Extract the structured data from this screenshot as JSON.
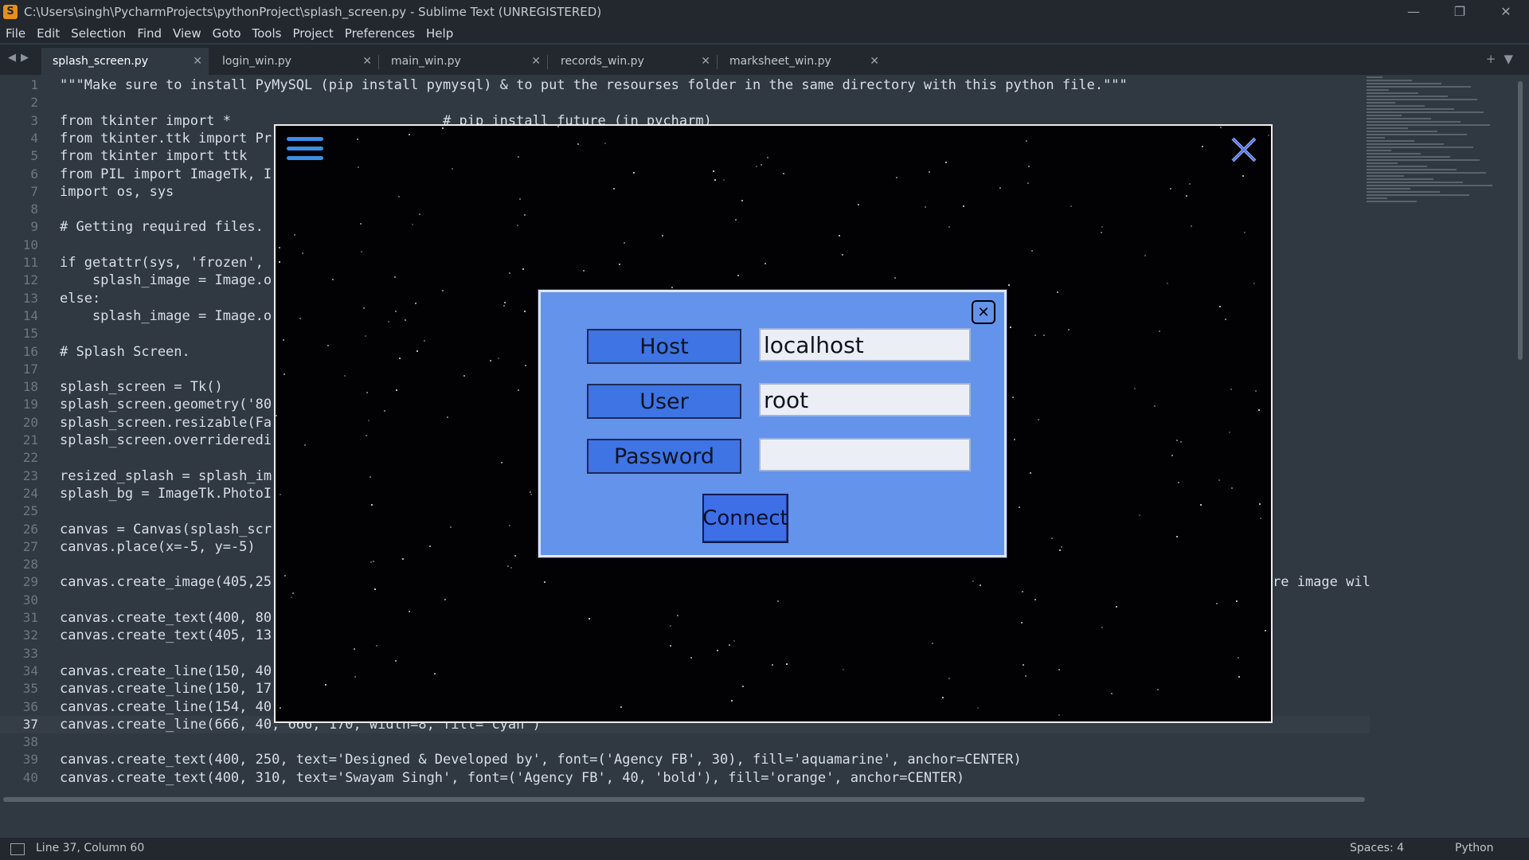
{
  "titlebar": {
    "title": "C:\\Users\\singh\\PycharmProjects\\pythonProject\\splash_screen.py - Sublime Text (UNREGISTERED)",
    "minimize": "—",
    "restore": "❐",
    "close": "✕"
  },
  "menu": [
    "File",
    "Edit",
    "Selection",
    "Find",
    "View",
    "Goto",
    "Tools",
    "Project",
    "Preferences",
    "Help"
  ],
  "tabs": [
    {
      "label": "splash_screen.py",
      "active": true
    },
    {
      "label": "login_win.py",
      "active": false
    },
    {
      "label": "main_win.py",
      "active": false
    },
    {
      "label": "records_win.py",
      "active": false
    },
    {
      "label": "marksheet_win.py",
      "active": false
    }
  ],
  "editor": {
    "current_line": 37,
    "lines": [
      "\"\"\"Make sure to install PyMySQL (pip install pymysql) & to put the resourses folder in the same directory with this python file.\"\"\"",
      "",
      "from tkinter import *                          # pip install future (in pycharm)",
      "from tkinter.ttk import Pr",
      "from tkinter import ttk",
      "from PIL import ImageTk, I",
      "import os, sys",
      "",
      "# Getting required files.",
      "",
      "if getattr(sys, 'frozen',",
      "    splash_image = Image.o",
      "else:",
      "    splash_image = Image.o",
      "",
      "# Splash Screen.",
      "",
      "splash_screen = Tk()",
      "splash_screen.geometry('80",
      "splash_screen.resizable(Fa",
      "splash_screen.overrideredi",
      "",
      "resized_splash = splash_im",
      "splash_bg = ImageTk.PhotoI",
      "",
      "canvas = Canvas(splash_scr",
      "canvas.place(x=-5, y=-5)",
      "",
      "canvas.create_image(405,25",
      "",
      "canvas.create_text(400, 80",
      "canvas.create_text(405, 13",
      "",
      "canvas.create_line(150, 40",
      "canvas.create_line(150, 17",
      "canvas.create_line(154, 40",
      "canvas.create_line(666, 40, 666, 170, width=8, fill='cyan')",
      "",
      "canvas.create_text(400, 250, text='Designed & Developed by', font=('Agency FB', 30), fill='aquamarine', anchor=CENTER)",
      "canvas.create_text(400, 310, text='Swayam Singh', font=('Agency FB', 40, 'bold'), fill='orange', anchor=CENTER)"
    ],
    "line29_tail": "re image wil"
  },
  "dialog": {
    "host_label": "Host",
    "host_value": "localhost",
    "user_label": "User",
    "user_value": "root",
    "password_label": "Password",
    "password_value": "",
    "connect_label": "Connect",
    "close_glyph": "✕"
  },
  "statusbar": {
    "position": "Line 37, Column 60",
    "indent": "Spaces: 4",
    "syntax": "Python"
  },
  "colors": {
    "editor_bg": "#303841",
    "dialog_bg": "#6393ea",
    "label_bg": "#3e74e4",
    "button_bg": "#3f6fe6",
    "hamburger": "#3a8ee6"
  },
  "icons": [
    "sublime-app-icon",
    "hamburger-menu-icon",
    "close-x-icon",
    "panel-toggle-icon"
  ]
}
